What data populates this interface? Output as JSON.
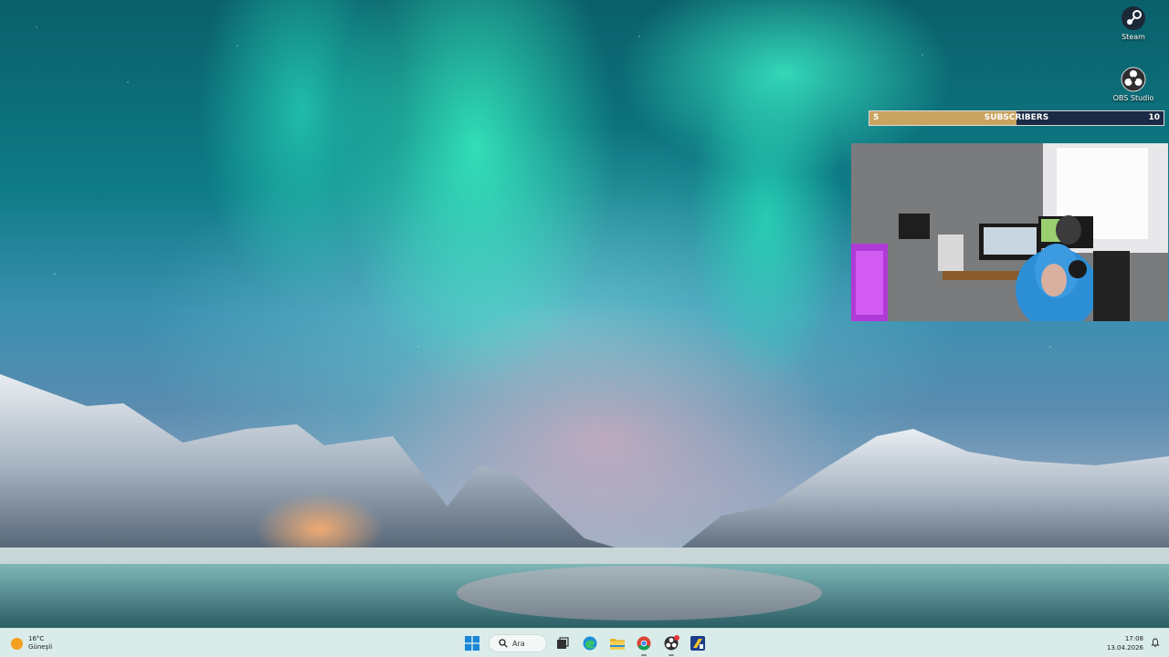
{
  "desktop": {
    "icons": [
      {
        "label": "Steam",
        "icon": "steam-icon"
      },
      {
        "label": "OBS Studio",
        "icon": "obs-studio-icon"
      }
    ]
  },
  "overlay": {
    "subscribers": {
      "label": "SUBSCRIBERS",
      "min": "5",
      "max": "10",
      "progress_fraction": 0.5,
      "fill_color": "#c9a461"
    }
  },
  "taskbar": {
    "weather": {
      "temperature": "16°C",
      "condition": "Güneşli"
    },
    "search": {
      "placeholder": "Ara"
    },
    "pinned_apps": [
      {
        "name": "windows-start-icon"
      },
      {
        "name": "search-icon"
      },
      {
        "name": "task-view-icon"
      },
      {
        "name": "edge-icon"
      },
      {
        "name": "file-explorer-icon"
      },
      {
        "name": "chrome-icon"
      },
      {
        "name": "obs-studio-icon"
      },
      {
        "name": "app-icon"
      }
    ],
    "clock": {
      "time": "17:08",
      "date": "13.04.2026"
    }
  }
}
